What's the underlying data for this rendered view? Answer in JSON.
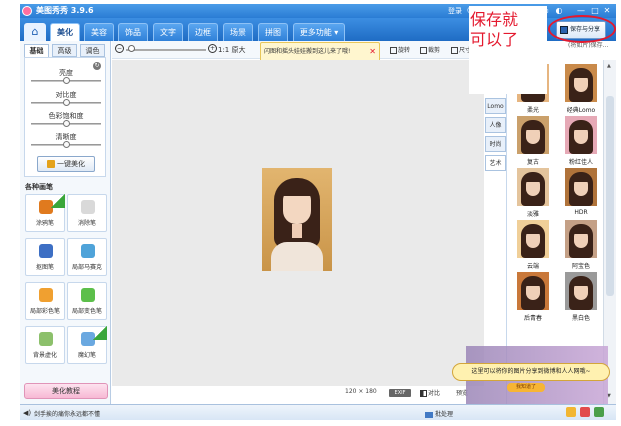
{
  "app": {
    "title": "美图秀秀 3.9.6",
    "login": "登录"
  },
  "menu": {
    "tabs": [
      {
        "label": "美化",
        "active": true
      },
      {
        "label": "美容"
      },
      {
        "label": "饰品"
      },
      {
        "label": "文字"
      },
      {
        "label": "边框"
      },
      {
        "label": "场景"
      },
      {
        "label": "拼图"
      },
      {
        "label": "更多功能 ▾"
      }
    ]
  },
  "overlay_note": {
    "line1": "保存就",
    "line2": "可以了"
  },
  "save": {
    "label": "保存与分享",
    "hint": "(将如片)保存..."
  },
  "left_panel": {
    "subtabs": [
      "基础",
      "高级",
      "调色"
    ],
    "sliders": [
      {
        "label": "亮度",
        "value": 0.5
      },
      {
        "label": "对比度",
        "value": 0.5
      },
      {
        "label": "色彩饱和度",
        "value": 0.5
      },
      {
        "label": "清晰度",
        "value": 0.5
      }
    ],
    "one_key": "一键美化",
    "brushes_title": "各种画笔",
    "brushes": [
      {
        "label": "涂鸦笔",
        "new": true,
        "color": "#e07a1e"
      },
      {
        "label": "消除笔",
        "new": false,
        "color": "#d9d9d9"
      },
      {
        "label": "抠图笔",
        "new": false,
        "color": "#3d6fc4"
      },
      {
        "label": "局部马赛克",
        "new": false,
        "color": "#4fa3d9"
      },
      {
        "label": "局部彩色笔",
        "new": false,
        "color": "#f0a030"
      },
      {
        "label": "局部变色笔",
        "new": false,
        "color": "#5cbf4a"
      },
      {
        "label": "背景虚化",
        "new": false,
        "color": "#8cc06b"
      },
      {
        "label": "魔幻笔",
        "new": true,
        "color": "#6aa8e0"
      }
    ],
    "tutorial": "美化教程"
  },
  "canvas_toolbar": {
    "original": "1:1 原大",
    "tip": "闪图和摇头娃娃搬到这儿来了哦!",
    "tools": [
      "旋转",
      "裁剪",
      "尺寸"
    ]
  },
  "canvas": {
    "size": "120 × 180",
    "exif": "EXIF",
    "compare": "对比",
    "preview": "预览"
  },
  "right_panel": {
    "vtabs": [
      "Lomo",
      "人像",
      "时尚",
      "艺术"
    ],
    "active_vtab": "艺术",
    "effects": [
      {
        "name": "柔光",
        "tint": "#e6b580"
      },
      {
        "name": "经典Lomo",
        "tint": "#c98a4a"
      },
      {
        "name": "复古",
        "tint": "#caa06b"
      },
      {
        "name": "粉红佳人",
        "tint": "#e6a9b6"
      },
      {
        "name": "淡雅",
        "tint": "#e4c49c"
      },
      {
        "name": "HDR",
        "tint": "#b0733a"
      },
      {
        "name": "云端",
        "tint": "#f0cf98"
      },
      {
        "name": "阿宝色",
        "tint": "#c4a086"
      },
      {
        "name": "后青春",
        "tint": "#c9783a"
      },
      {
        "name": "黑白色",
        "tint": "#9a9a9a"
      }
    ]
  },
  "promo": {
    "text": "这里可以将你的图片分享到微博和人人网哦~",
    "button": "我知道了"
  },
  "statusbar": {
    "message": "剑手挨的痛你永远都不懂",
    "batch": "批处理"
  }
}
